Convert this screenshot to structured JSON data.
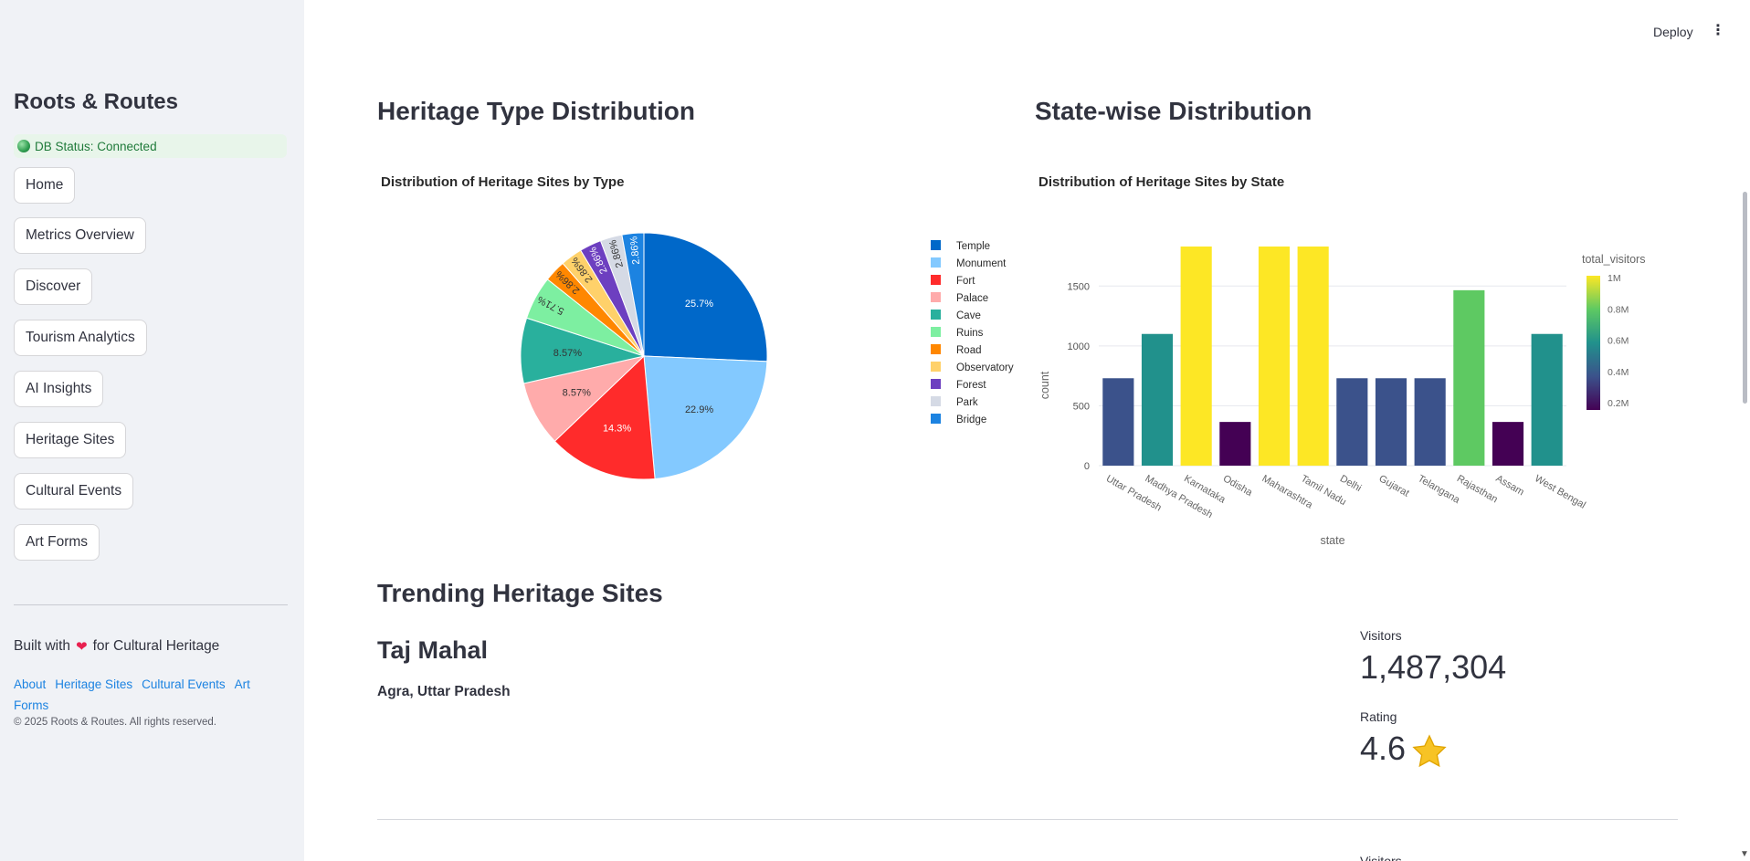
{
  "sidebar": {
    "app_title": "Roots & Routes",
    "db_status": "DB Status: Connected",
    "nav_items": [
      {
        "label": "Home"
      },
      {
        "label": "Metrics Overview"
      },
      {
        "label": "Discover"
      },
      {
        "label": "Tourism Analytics"
      },
      {
        "label": "AI Insights"
      },
      {
        "label": "Heritage Sites"
      },
      {
        "label": "Cultural Events"
      },
      {
        "label": "Art Forms"
      }
    ],
    "built_with_prefix": "Built with",
    "built_with_suffix": "for Cultural Heritage",
    "footer_links": [
      "About",
      "Heritage Sites",
      "Cultural Events",
      "Art Forms"
    ],
    "copyright": "© 2025 Roots & Routes. All rights reserved."
  },
  "header": {
    "deploy_label": "Deploy",
    "menu_icon": "more-vertical-icon"
  },
  "sections": {
    "heritage_type_title": "Heritage Type Distribution",
    "state_wise_title": "State-wise Distribution",
    "trending_title": "Trending Heritage Sites"
  },
  "trending": {
    "site_name": "Taj Mahal",
    "location": "Agra, Uttar Pradesh",
    "visitors_label": "Visitors",
    "visitors_value": "1,487,304",
    "rating_label": "Rating",
    "rating_value": "4.6",
    "rating_icon": "star-icon",
    "next_visitors_label": "Visitors"
  },
  "chart_data": [
    {
      "type": "pie",
      "title": "Distribution of Heritage Sites by Type",
      "labels": [
        "Temple",
        "Monument",
        "Fort",
        "Palace",
        "Cave",
        "Ruins",
        "Road",
        "Observatory",
        "Forest",
        "Park",
        "Bridge"
      ],
      "values": [
        25.7,
        22.9,
        14.3,
        8.57,
        8.57,
        5.71,
        2.86,
        2.86,
        2.86,
        2.86,
        2.86
      ],
      "slice_labels": [
        "25.7%",
        "22.9%",
        "14.3%",
        "8.57%",
        "8.57%",
        "5.71%",
        "2.86%",
        "2.86%",
        "2.86%",
        "2.86%",
        "2.86%"
      ],
      "colors": [
        "#0068c9",
        "#83c9ff",
        "#ff2b2b",
        "#ffabab",
        "#29b09d",
        "#7defa1",
        "#ff8700",
        "#ffd16a",
        "#6d3fc0",
        "#d5dae5",
        "#1c83e1"
      ],
      "legend_position": "right"
    },
    {
      "type": "bar",
      "title": "Distribution of Heritage Sites by State",
      "xlabel": "state",
      "ylabel": "count",
      "categories": [
        "Uttar Pradesh",
        "Madhya Pradesh",
        "Karnataka",
        "Odisha",
        "Maharashtra",
        "Tamil Nadu",
        "Delhi",
        "Gujarat",
        "Telangana",
        "Rajasthan",
        "Assam",
        "West Bengal"
      ],
      "values": [
        730,
        1100,
        1830,
        365,
        1830,
        1830,
        730,
        730,
        730,
        1465,
        365,
        1100
      ],
      "color_values_millions": [
        0.4,
        0.6,
        1.0,
        0.2,
        1.0,
        1.0,
        0.4,
        0.4,
        0.4,
        0.8,
        0.2,
        0.6
      ],
      "y_ticks": [
        0,
        500,
        1000,
        1500
      ],
      "ylim": [
        0,
        1830
      ],
      "colorbar": {
        "title": "total_visitors",
        "ticks": [
          "1M",
          "0.8M",
          "0.6M",
          "0.4M",
          "0.2M"
        ],
        "range": [
          0.2,
          1.0
        ]
      },
      "grid": true
    }
  ]
}
